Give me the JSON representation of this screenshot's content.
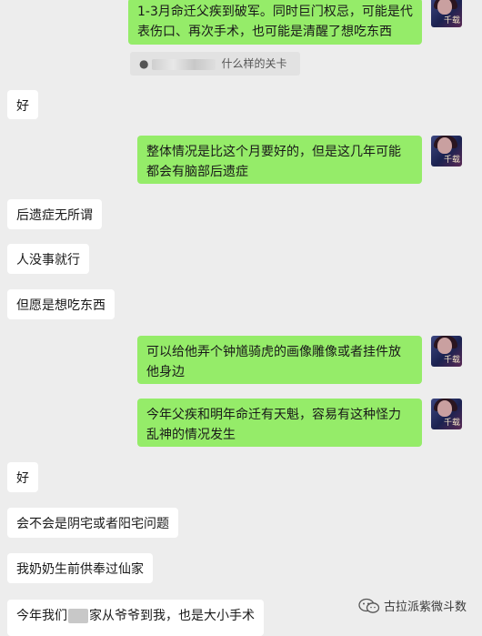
{
  "messages": [
    {
      "side": "out",
      "text": "1-3月命迁父疾到破军。同时巨门权忌，可能是代表伤口、再次手术，也可能是清醒了想吃东西"
    },
    {
      "side": "quote",
      "prefix": "",
      "text": "什么样的关卡"
    },
    {
      "side": "in",
      "text": "好"
    },
    {
      "side": "out",
      "text": "整体情况是比这个月要好的，但是这几年可能都会有脑部后遗症"
    },
    {
      "side": "in",
      "text": "后遗症无所谓"
    },
    {
      "side": "in",
      "text": "人没事就行"
    },
    {
      "side": "in",
      "text": "但愿是想吃东西"
    },
    {
      "side": "out",
      "text": "可以给他弄个钟馗骑虎的画像雕像或者挂件放他身边"
    },
    {
      "side": "out",
      "text": "今年父疾和明年命迁有天魁，容易有这种怪力乱神的情况发生"
    },
    {
      "side": "in",
      "text": "好"
    },
    {
      "side": "in",
      "text": "会不会是阴宅或者阳宅问题"
    },
    {
      "side": "in",
      "text": "我奶奶生前供奉过仙家"
    },
    {
      "side": "in",
      "text_a": "今年我们",
      "text_b": "家从爷爷到我，也是大小手术"
    }
  ],
  "avatar": {
    "glyph": "千载"
  },
  "watermark": {
    "text": "古拉派紫微斗数",
    "icon": "wechat-icon"
  },
  "colors": {
    "out_bubble": "#95ec69",
    "in_bubble": "#ffffff",
    "background": "#ededed"
  }
}
